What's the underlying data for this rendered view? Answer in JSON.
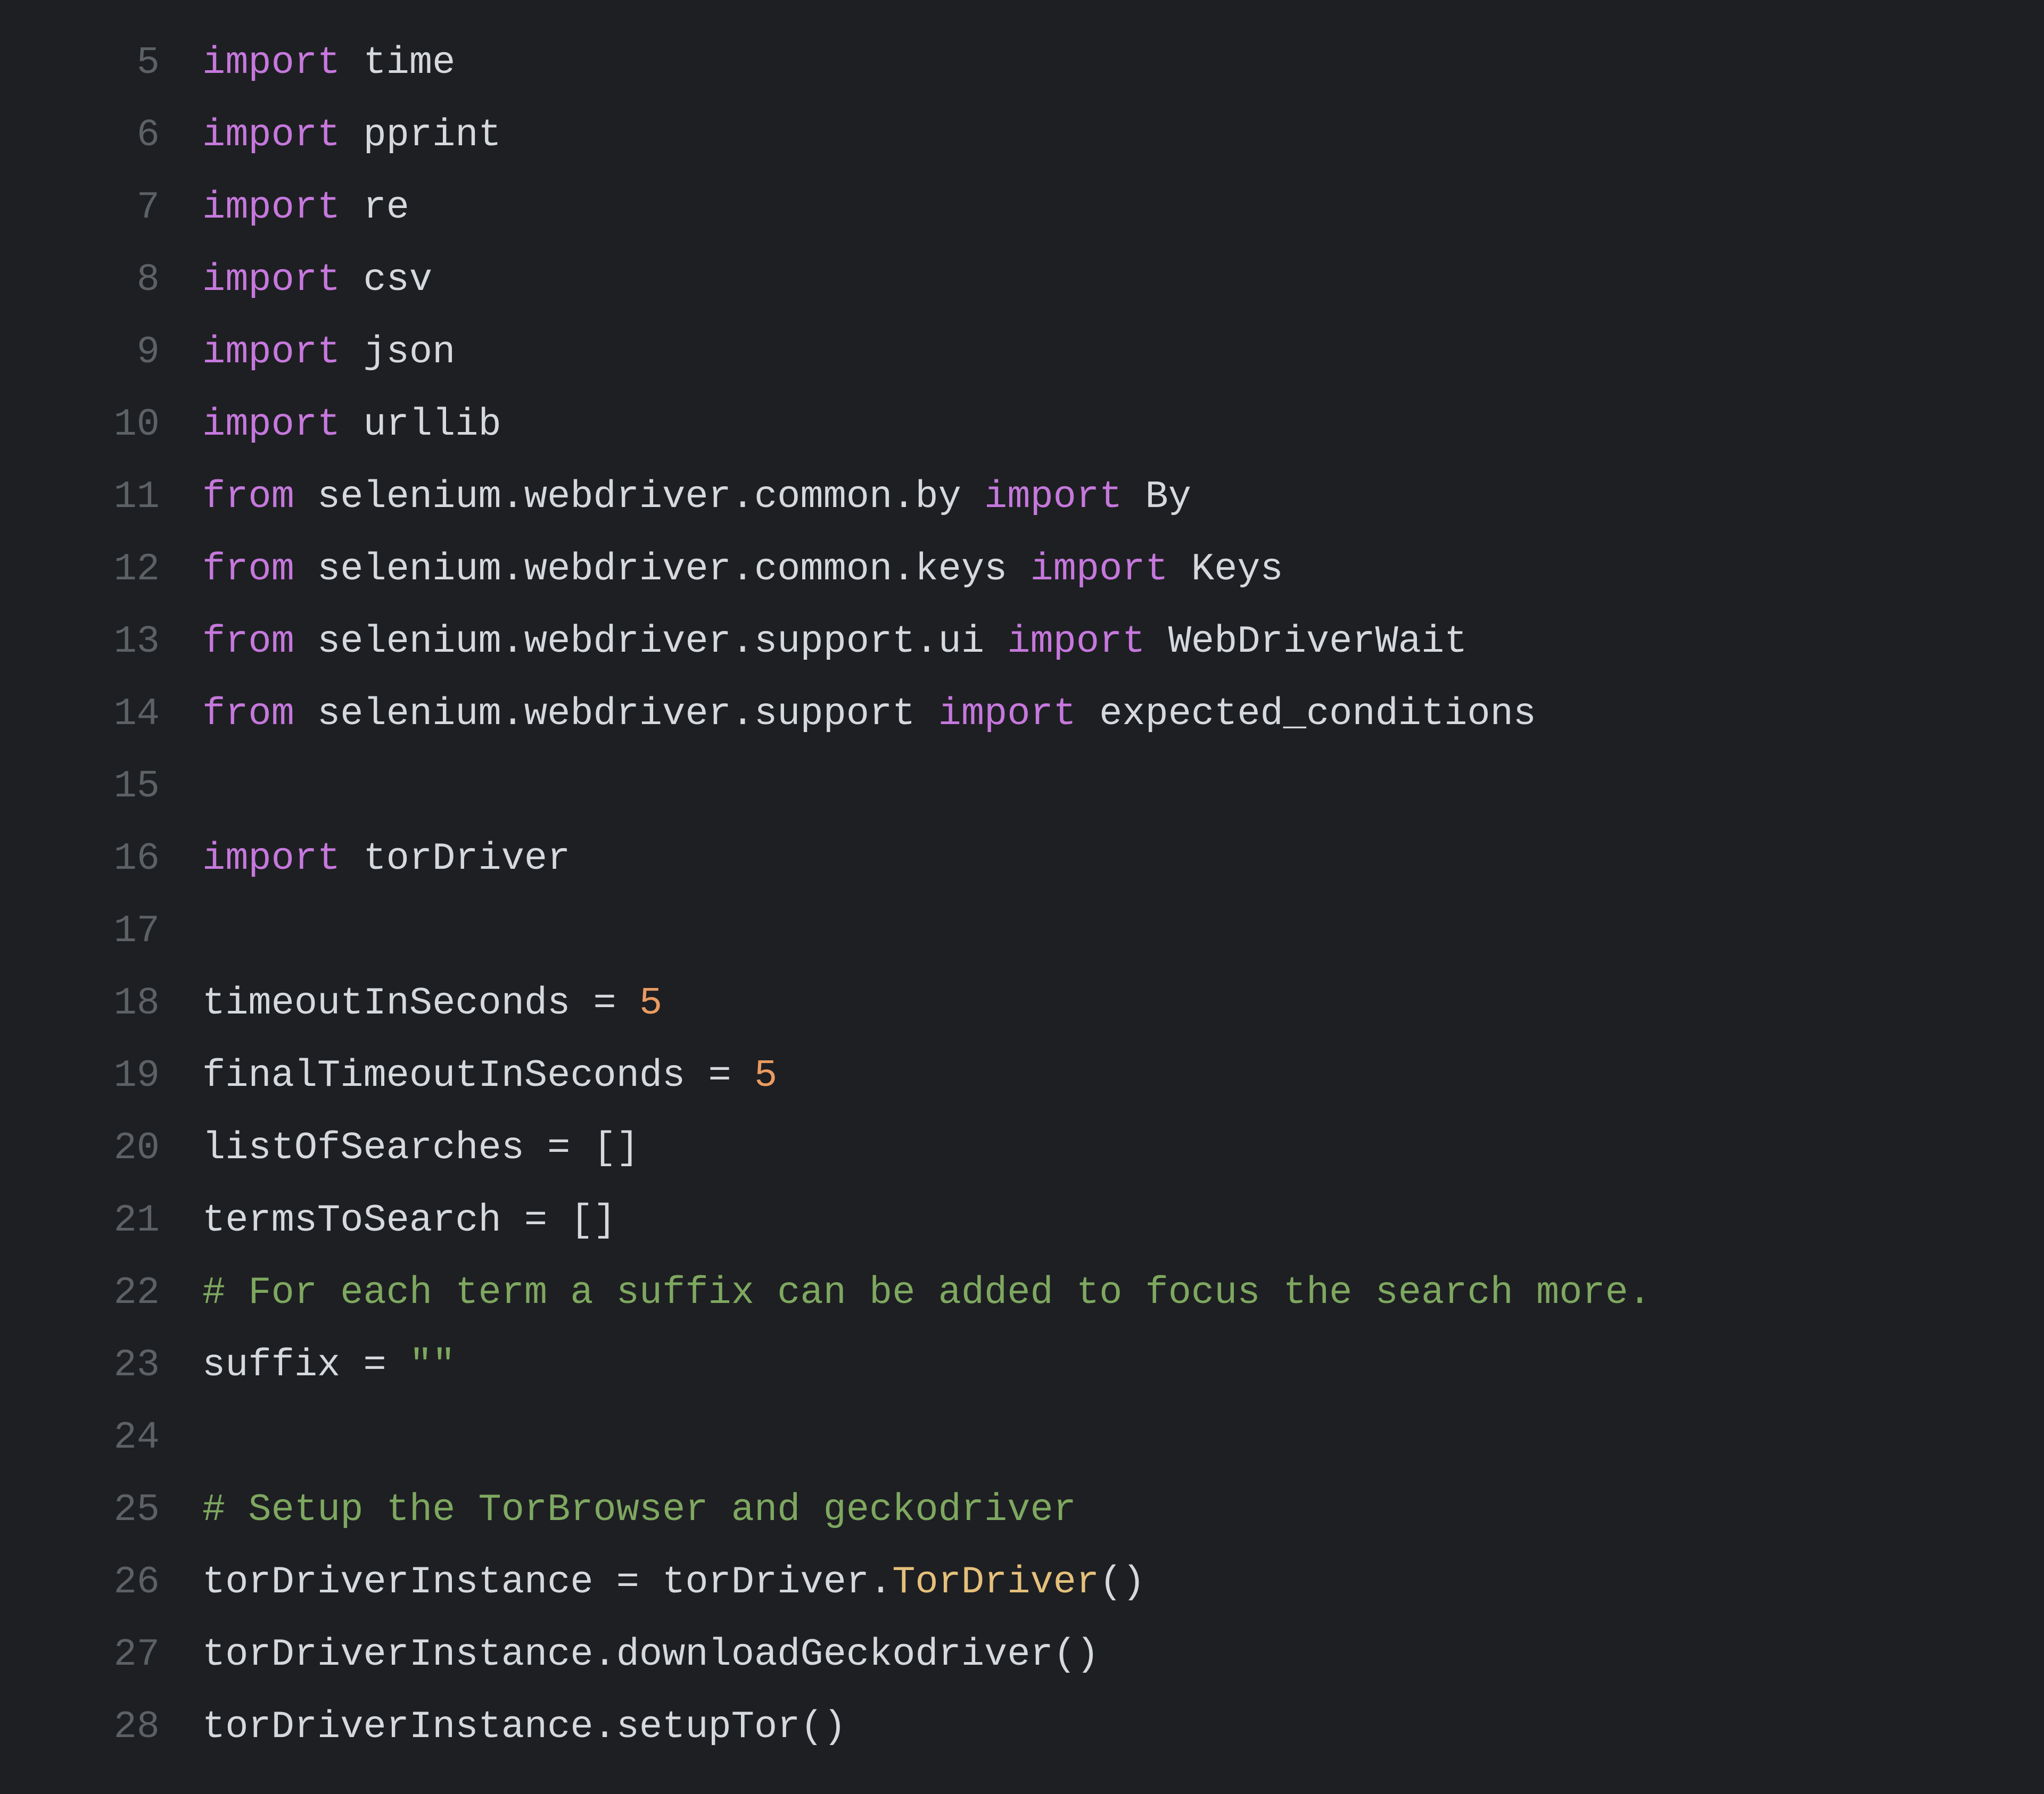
{
  "colors": {
    "background": "#1e1f22",
    "line_number": "#5c6166",
    "keyword": "#c678dd",
    "default": "#d5d9dd",
    "number": "#ea9b62",
    "comment": "#7ea860",
    "string": "#7ea860",
    "classname": "#e5c07b"
  },
  "lines": [
    {
      "n": "5",
      "tokens": [
        {
          "cls": "t-kw",
          "text": "import"
        },
        {
          "cls": "t-def",
          "text": " time"
        }
      ]
    },
    {
      "n": "6",
      "tokens": [
        {
          "cls": "t-kw",
          "text": "import"
        },
        {
          "cls": "t-def",
          "text": " pprint"
        }
      ]
    },
    {
      "n": "7",
      "tokens": [
        {
          "cls": "t-kw",
          "text": "import"
        },
        {
          "cls": "t-def",
          "text": " re"
        }
      ]
    },
    {
      "n": "8",
      "tokens": [
        {
          "cls": "t-kw",
          "text": "import"
        },
        {
          "cls": "t-def",
          "text": " csv"
        }
      ]
    },
    {
      "n": "9",
      "tokens": [
        {
          "cls": "t-kw",
          "text": "import"
        },
        {
          "cls": "t-def",
          "text": " json"
        }
      ]
    },
    {
      "n": "10",
      "tokens": [
        {
          "cls": "t-kw",
          "text": "import"
        },
        {
          "cls": "t-def",
          "text": " urllib"
        }
      ]
    },
    {
      "n": "11",
      "tokens": [
        {
          "cls": "t-kw",
          "text": "from"
        },
        {
          "cls": "t-def",
          "text": " selenium.webdriver.common.by "
        },
        {
          "cls": "t-kw",
          "text": "import"
        },
        {
          "cls": "t-def",
          "text": " By"
        }
      ]
    },
    {
      "n": "12",
      "tokens": [
        {
          "cls": "t-kw",
          "text": "from"
        },
        {
          "cls": "t-def",
          "text": " selenium.webdriver.common.keys "
        },
        {
          "cls": "t-kw",
          "text": "import"
        },
        {
          "cls": "t-def",
          "text": " Keys"
        }
      ]
    },
    {
      "n": "13",
      "tokens": [
        {
          "cls": "t-kw",
          "text": "from"
        },
        {
          "cls": "t-def",
          "text": " selenium.webdriver.support.ui "
        },
        {
          "cls": "t-kw",
          "text": "import"
        },
        {
          "cls": "t-def",
          "text": " WebDriverWait"
        }
      ]
    },
    {
      "n": "14",
      "tokens": [
        {
          "cls": "t-kw",
          "text": "from"
        },
        {
          "cls": "t-def",
          "text": " selenium.webdriver.support "
        },
        {
          "cls": "t-kw",
          "text": "import"
        },
        {
          "cls": "t-def",
          "text": " expected_conditions"
        }
      ]
    },
    {
      "n": "15",
      "tokens": [
        {
          "cls": "t-def",
          "text": ""
        }
      ]
    },
    {
      "n": "16",
      "tokens": [
        {
          "cls": "t-kw",
          "text": "import"
        },
        {
          "cls": "t-def",
          "text": " torDriver"
        }
      ]
    },
    {
      "n": "17",
      "tokens": [
        {
          "cls": "t-def",
          "text": ""
        }
      ]
    },
    {
      "n": "18",
      "tokens": [
        {
          "cls": "t-def",
          "text": "timeoutInSeconds = "
        },
        {
          "cls": "t-num",
          "text": "5"
        }
      ]
    },
    {
      "n": "19",
      "tokens": [
        {
          "cls": "t-def",
          "text": "finalTimeoutInSeconds = "
        },
        {
          "cls": "t-num",
          "text": "5"
        }
      ]
    },
    {
      "n": "20",
      "tokens": [
        {
          "cls": "t-def",
          "text": "listOfSearches = []"
        }
      ]
    },
    {
      "n": "21",
      "tokens": [
        {
          "cls": "t-def",
          "text": "termsToSearch = []"
        }
      ]
    },
    {
      "n": "22",
      "tokens": [
        {
          "cls": "t-cmt",
          "text": "# For each term a suffix can be added to focus the search more."
        }
      ]
    },
    {
      "n": "23",
      "tokens": [
        {
          "cls": "t-def",
          "text": "suffix = "
        },
        {
          "cls": "t-str",
          "text": "\"\""
        }
      ]
    },
    {
      "n": "24",
      "tokens": [
        {
          "cls": "t-def",
          "text": ""
        }
      ]
    },
    {
      "n": "25",
      "tokens": [
        {
          "cls": "t-cmt",
          "text": "# Setup the TorBrowser and geckodriver"
        }
      ]
    },
    {
      "n": "26",
      "tokens": [
        {
          "cls": "t-def",
          "text": "torDriverInstance = torDriver."
        },
        {
          "cls": "t-cls",
          "text": "TorDriver"
        },
        {
          "cls": "t-def",
          "text": "()"
        }
      ]
    },
    {
      "n": "27",
      "tokens": [
        {
          "cls": "t-def",
          "text": "torDriverInstance.downloadGeckodriver()"
        }
      ]
    },
    {
      "n": "28",
      "tokens": [
        {
          "cls": "t-def",
          "text": "torDriverInstance.setupTor()"
        }
      ]
    }
  ]
}
